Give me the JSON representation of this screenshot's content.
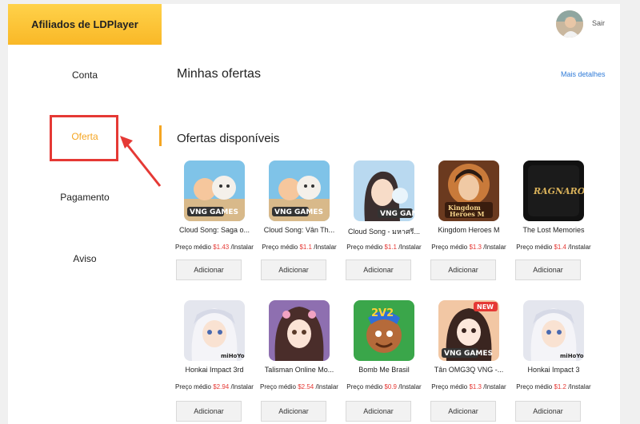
{
  "sidebar": {
    "brand": "Afiliados de LDPlayer",
    "items": [
      {
        "label": "Conta"
      },
      {
        "label": "Oferta"
      },
      {
        "label": "Pagamento"
      },
      {
        "label": "Aviso"
      }
    ]
  },
  "header": {
    "logout": "Sair"
  },
  "main": {
    "my_offers_title": "Minhas ofertas",
    "details_link": "Mais detalhes",
    "available_title": "Ofertas disponíveis",
    "price_prefix": "Preço médio",
    "price_suffix": "/Instalar",
    "add_label": "Adicionar",
    "offers": [
      {
        "name": "Cloud Song: Saga o...",
        "price": "$1.43",
        "icon": "cloud-song-icon"
      },
      {
        "name": "Cloud Song: Vân Th...",
        "price": "$1.1",
        "icon": "cloud-song-icon"
      },
      {
        "name": "Cloud Song - มหาศรี...",
        "price": "$1.1",
        "icon": "cloud-song-girl-icon"
      },
      {
        "name": "Kingdom Heroes M",
        "price": "$1.3",
        "icon": "kingdom-heroes-icon"
      },
      {
        "name": "The Lost Memories",
        "price": "$1.4",
        "icon": "ragnarok-icon"
      },
      {
        "name": "Honkai Impact 3rd",
        "price": "$2.94",
        "icon": "honkai-icon"
      },
      {
        "name": "Talisman Online Mo...",
        "price": "$2.54",
        "icon": "talisman-icon"
      },
      {
        "name": "Bomb Me Brasil",
        "price": "$0.9",
        "icon": "bomb-me-icon"
      },
      {
        "name": "Tân OMG3Q VNG -...",
        "price": "$1.3",
        "icon": "omg3q-icon"
      },
      {
        "name": "Honkai Impact 3",
        "price": "$1.2",
        "icon": "honkai-icon"
      }
    ]
  },
  "colors": {
    "accent": "#f5a623",
    "highlight": "#e53935",
    "link": "#2f7bd8"
  }
}
